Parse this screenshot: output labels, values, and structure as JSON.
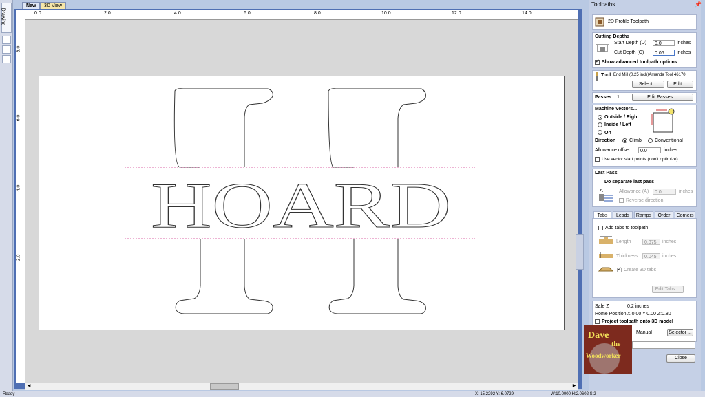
{
  "tabs": {
    "new_label": "New",
    "view3d_label": "3D View",
    "drawing_label": "Drawing"
  },
  "ruler": {
    "top_ticks": [
      "0.0",
      "2.0",
      "4.0",
      "6.0",
      "8.0",
      "10.0",
      "12.0",
      "14.0"
    ],
    "left_ticks": [
      "8.0",
      "6.0",
      "4.0",
      "2.0"
    ]
  },
  "panel": {
    "header": "Toolpaths",
    "title": "2D Profile Toolpath",
    "cutting_depths": {
      "title": "Cutting Depths",
      "start_label": "Start Depth (D)",
      "start_value": "0.0",
      "start_unit": "inches",
      "cut_label": "Cut Depth (C)",
      "cut_value": "0.06",
      "cut_unit": "inches",
      "advanced_label": "Show advanced toolpath options"
    },
    "tool": {
      "label": "Tool:",
      "value": "End Mill (0.25 inch)Amanda Tool 46170",
      "select_btn": "Select ...",
      "edit_btn": "Edit ..."
    },
    "passes": {
      "label": "Passes:",
      "value": "1",
      "edit_btn": "Edit Passes ..."
    },
    "machine_vectors": {
      "title": "Machine Vectors...",
      "outside": "Outside / Right",
      "inside": "Inside / Left",
      "on": "On",
      "direction_label": "Direction",
      "climb": "Climb",
      "conventional": "Conventional",
      "allowance_label": "Allowance offset",
      "allowance_value": "0.0",
      "allowance_unit": "inches",
      "start_points_label": "Use vector start points (don't optimize)"
    },
    "last_pass": {
      "title": "Last Pass",
      "separate_label": "Do separate last pass",
      "allowance_label": "Allowance (A)",
      "allowance_value": "0.0",
      "allowance_unit": "inches",
      "reverse_label": "Reverse direction"
    },
    "sub_tabs": [
      "Tabs",
      "Leads",
      "Ramps",
      "Order",
      "Corners"
    ],
    "tabs_section": {
      "add_label": "Add tabs to toolpath",
      "length_label": "Length",
      "length_value": "0.375",
      "length_unit": "inches",
      "thickness_label": "Thickness",
      "thickness_value": "0.045",
      "thickness_unit": "inches",
      "create3d_label": "Create 3D tabs",
      "edit_btn": "Edit Tabs ..."
    },
    "bottom": {
      "safe_z_label": "Safe Z",
      "safe_z_value": "0.2 inches",
      "home_label": "Home Position",
      "home_value": "X:0.00 Y:0.00 Z:0.80",
      "project_label": "Project toolpath onto 3D model",
      "manual_label": "Manual",
      "selector_btn": "Selector ...",
      "close_btn": "Close"
    }
  },
  "canvas": {
    "letters": "HOARD"
  },
  "status": {
    "left": "Ready",
    "coords": "X: 15.2292 Y: 6.0729",
    "size": "W:10.0000  H:2.0602  S:2"
  },
  "logo": {
    "line1": "Dave",
    "line2": "the",
    "line3": "Woodworker"
  },
  "colors": {
    "panel_bg": "#c5d0e6",
    "frame_blue": "#4f6fb3",
    "guide_line": "#d0368a"
  }
}
